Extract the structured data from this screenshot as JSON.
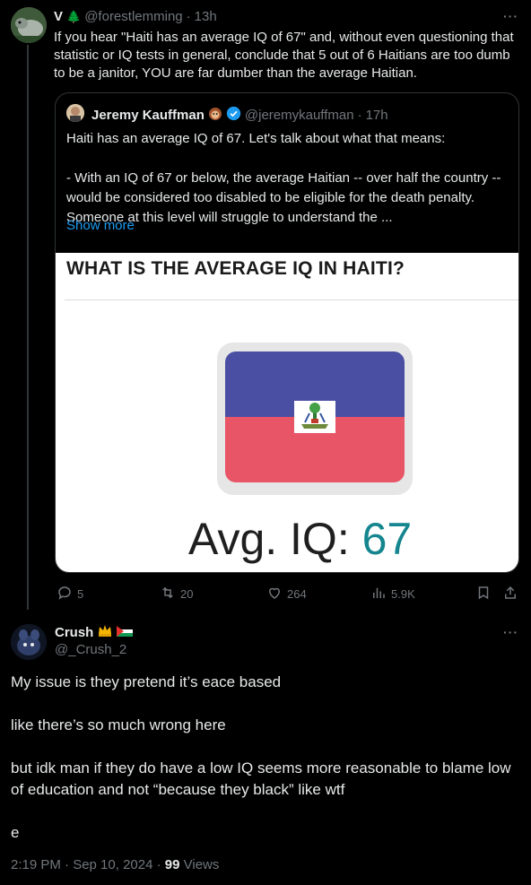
{
  "post1": {
    "display_name": "V",
    "name_emoji": "🌲",
    "handle": "@forestlemming",
    "time": "13h",
    "text": "If you hear \"Haiti has an average IQ of 67\" and, without even questioning that statistic or IQ tests in general,  conclude that 5 out of 6 Haitians are too dumb to be a janitor, YOU are far dumber than the average Haitian.",
    "more_label": "···"
  },
  "quote": {
    "display_name": "Jeremy Kauffman",
    "handle": "@jeremykauffman",
    "time": "17h",
    "line1": "Haiti has an average IQ of 67. Let's talk about what that means:",
    "line2": "- With an IQ of 67 or below, the average Haitian -- over half the country -- would be considered too disabled to be eligible for the death penalty. Someone at this level will struggle to understand the  ...",
    "show_more": "Show more",
    "image": {
      "title": "WHAT IS THE AVERAGE IQ IN HAITI?",
      "iq_label": "Avg. IQ: ",
      "iq_value": "67"
    }
  },
  "actions": {
    "replies": "5",
    "reposts": "20",
    "likes": "264",
    "views": "5.9K"
  },
  "post2": {
    "display_name": "Crush",
    "handle": "@_Crush_2",
    "more_label": "···",
    "paragraphs": [
      "My issue is they pretend it’s eace based",
      "like there’s so much wrong here",
      "but idk man if they do have a low IQ seems more reasonable to blame low of education and not “because they black” like wtf",
      "e"
    ],
    "timestamp": "2:19 PM · Sep 10, 2024 · ",
    "views_count": "99",
    "views_label": " Views"
  },
  "colors": {
    "background": "#000000",
    "accent": "#1d9bf0",
    "muted": "#71767b",
    "text": "#e7e9ea",
    "flag_blue": "#4a4fa3",
    "flag_red": "#e85567",
    "iq_value": "#15868f"
  }
}
